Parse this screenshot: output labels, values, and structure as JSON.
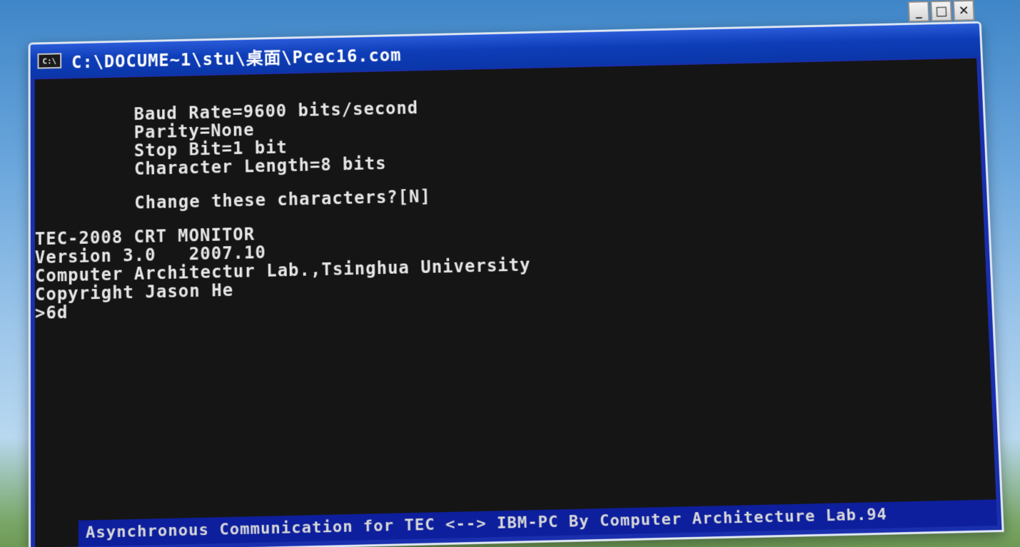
{
  "window": {
    "title": "C:\\DOCUME~1\\stu\\桌面\\Pcec16.com",
    "icon_label": "C:\\",
    "controls": {
      "minimize": "_",
      "maximize": "□",
      "close": "✕"
    }
  },
  "console": {
    "settings": [
      "Baud Rate=9600 bits/second",
      "Parity=None",
      "Stop Bit=1 bit",
      "Character Length=8 bits"
    ],
    "prompt_question": "Change these characters?[N]",
    "monitor": [
      "TEC-2008 CRT MONITOR",
      "Version 3.0   2007.10",
      "Computer Architectur Lab.,Tsinghua University",
      "Copyright Jason He",
      ">6d"
    ]
  },
  "status_bar": {
    "text": "Asynchronous Communication for TEC <--> IBM-PC By Computer Architecture Lab.94"
  }
}
